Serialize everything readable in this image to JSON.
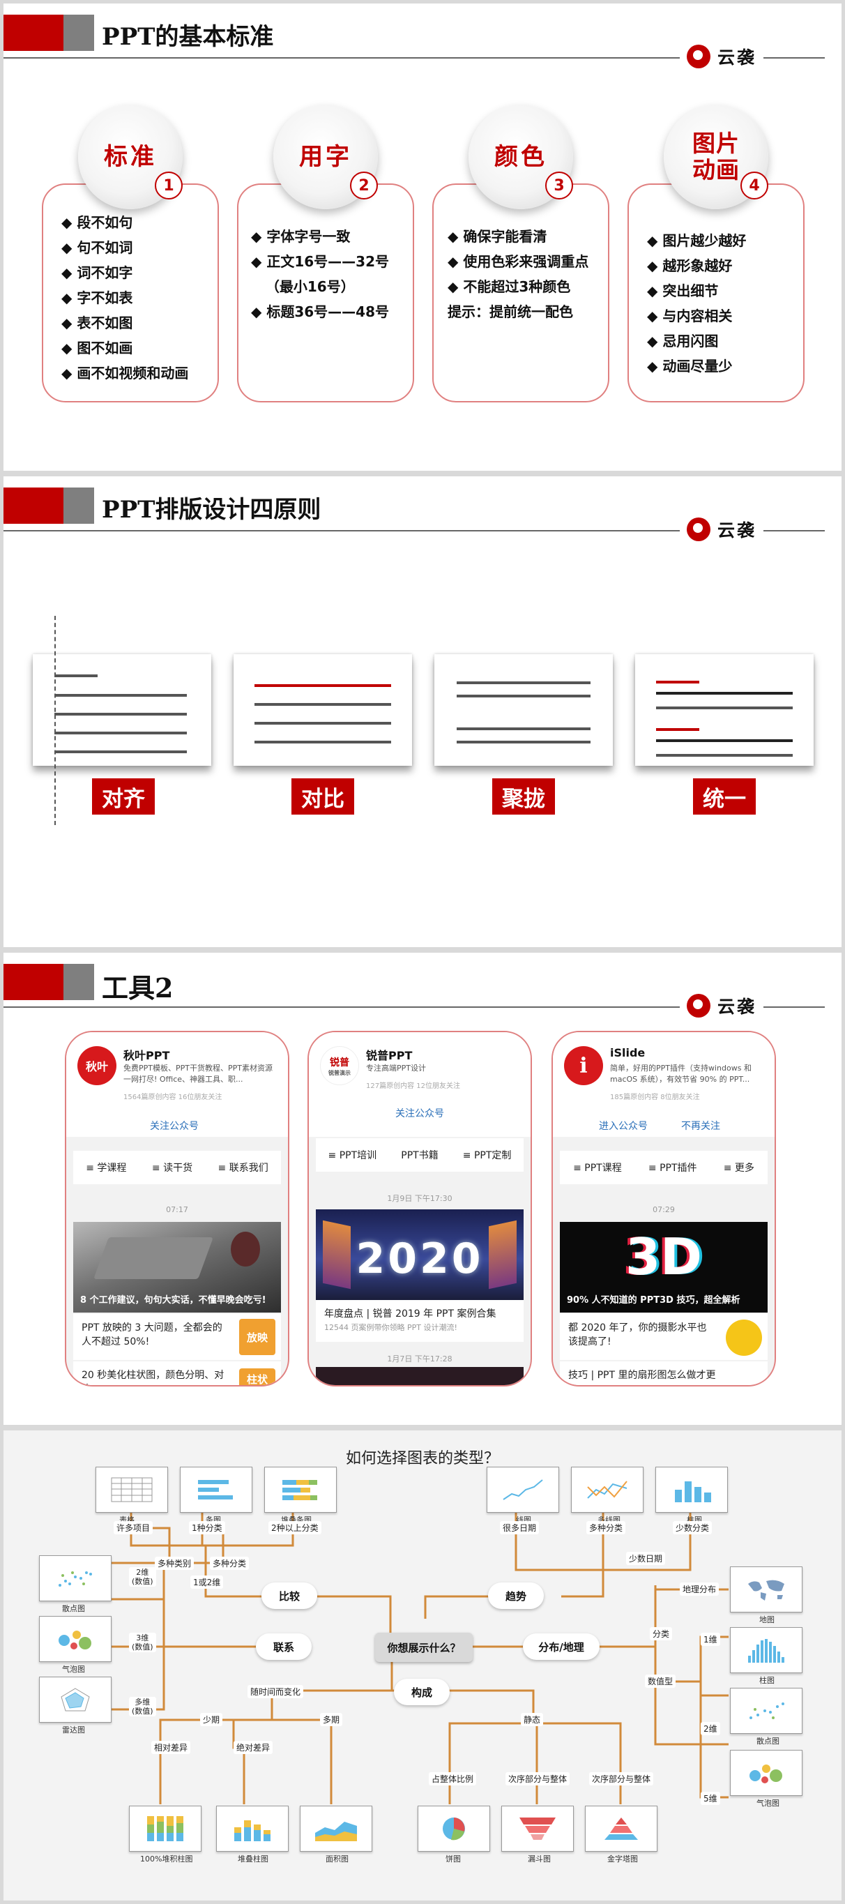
{
  "logo_text": "云袭",
  "slide1": {
    "title": "PPT的基本标准",
    "cards": [
      {
        "label": "标准",
        "number": "1",
        "items": [
          "◆ 段不如句",
          "◆ 句不如词",
          "◆ 词不如字",
          "◆ 字不如表",
          "◆ 表不如图",
          "◆ 图不如画",
          "◆ 画不如视频和动画"
        ]
      },
      {
        "label": "用字",
        "number": "2",
        "items": [
          "◆ 字体字号一致",
          "◆ 正文16号——32号",
          "   （最小16号）",
          "◆ 标题36号——48号"
        ]
      },
      {
        "label": "颜色",
        "number": "3",
        "items": [
          "◆ 确保字能看清",
          "◆ 使用色彩来强调重点",
          "◆ 不能超过3种颜色",
          "提示：提前统一配色"
        ]
      },
      {
        "label": "图片动画",
        "number": "4",
        "items": [
          "◆ 图片越少越好",
          "◆ 越形象越好",
          "◆ 突出细节",
          "◆ 与内容相关",
          "◆ 忌用闪图",
          "◆ 动画尽量少"
        ]
      }
    ]
  },
  "slide2": {
    "title": "PPT排版设计四原则",
    "principles": [
      "对齐",
      "对比",
      "聚拢",
      "统一"
    ]
  },
  "slide3": {
    "title": "工具2",
    "phones": [
      {
        "avatar": "秋叶",
        "name": "秋叶PPT",
        "desc": "免费PPT模板、PPT干货教程、PPT素材资源一网打尽! Office、神器工具、职...",
        "stats": "1564篇原创内容   16位朋友关注",
        "follow": "关注公众号",
        "menu": [
          "≡ 学课程",
          "≡ 读干货",
          "≡ 联系我们"
        ],
        "time1": "07:17",
        "img_caption": "8 个工作建议，句句大实话，不懂早晚会吃亏!",
        "article": "PPT 放映的 3 大问题，全都会的人不超过 50%!",
        "article_thumb": "放映",
        "article2": "20 秒美化柱状图，颜色分明、对比",
        "article2_thumb": "柱状"
      },
      {
        "avatar": "锐普",
        "avatar_sub": "锐普演示",
        "name": "锐普PPT",
        "desc": "专注高端PPT设计",
        "stats": "127篇原创内容   12位朋友关注",
        "follow": "关注公众号",
        "menu": [
          "≡ PPT培训",
          "PPT书籍",
          "≡ PPT定制"
        ],
        "time1": "1月9日 下午17:30",
        "img_text": "2020",
        "article": "年度盘点 | 锐普 2019 年 PPT 案例合集",
        "article_sub": "12544 页案例带你领略 PPT 设计潮流!",
        "time2": "1月7日 下午17:28"
      },
      {
        "name": "iSlide",
        "desc": "简单，好用的PPT插件（支持windows 和 macOS 系统），有效节省 90% 的 PPT...",
        "stats": "185篇原创内容   8位朋友关注",
        "follow": "进入公众号",
        "unfollow": "不再关注",
        "menu": [
          "≡ PPT课程",
          "≡ PPT插件",
          "≡ 更多"
        ],
        "time1": "07:29",
        "img_text": "3D",
        "img_caption": "90% 人不知道的 PPT3D 技巧，超全解析",
        "article": "都 2020 年了，你的摄影水平也该提高了!",
        "article2": "技巧 | PPT 里的扇形图怎么做才更"
      }
    ]
  },
  "slide4": {
    "title": "如何选择图表的类型？",
    "center": "你想展示什么？",
    "categories": {
      "compare": "比较",
      "trend": "趋势",
      "relation": "联系",
      "distribution": "分布/地理",
      "composition": "构成"
    },
    "nodes": {
      "table": "表格",
      "bar": "条图",
      "stacked_bar": "堆叠条图",
      "line": "线图",
      "multi_line": "多线图",
      "column_top": "柱图",
      "scatter_left": "散点图",
      "bubble_left": "气泡图",
      "radar": "雷达图",
      "map": "地图",
      "column_right": "柱图",
      "scatter_right": "散点图",
      "bubble_right": "气泡图",
      "stacked_100": "100%堆积柱图",
      "stacked_col": "堆叠柱图",
      "area": "面积图",
      "pie": "饼图",
      "funnel": "漏斗图",
      "pyramid": "金字塔图"
    },
    "tags": {
      "many_items": "许多项目",
      "one_class": "1种分类",
      "two_class": "2种以上分类",
      "multi_class": "多种类别",
      "multi_class2": "多种分类",
      "one_or_two": "1或2维",
      "many_dates": "很多日期",
      "multi_class3": "多种分类",
      "few_class": "少数分类",
      "few_dates": "少数日期",
      "dim2": "2维\n(数值)",
      "dim3": "3维\n(数值)",
      "multi_dim": "多维\n(数值)",
      "geo": "地理分布",
      "classify": "分类",
      "numeric": "数值型",
      "d1": "1维",
      "d2": "2维",
      "d5": "5维",
      "over_time": "随时间而变化",
      "few_periods": "少期",
      "many_periods": "多期",
      "rel_diff": "相对差异",
      "abs_diff": "绝对差异",
      "static": "静态",
      "share": "占整体比例",
      "order_part": "次序部分与整体",
      "order_part2": "次序部分与整体"
    }
  }
}
